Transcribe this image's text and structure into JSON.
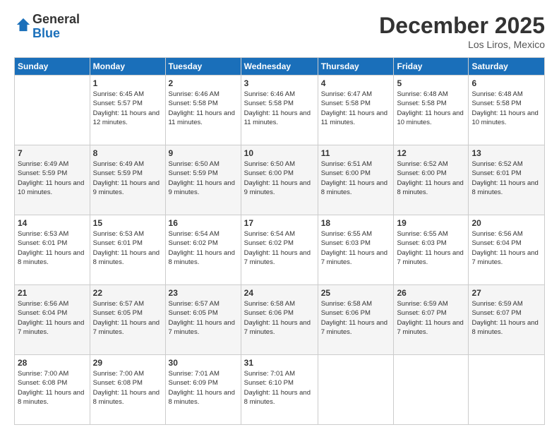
{
  "header": {
    "logo_general": "General",
    "logo_blue": "Blue",
    "month_title": "December 2025",
    "location": "Los Liros, Mexico"
  },
  "days_of_week": [
    "Sunday",
    "Monday",
    "Tuesday",
    "Wednesday",
    "Thursday",
    "Friday",
    "Saturday"
  ],
  "weeks": [
    [
      {
        "num": "",
        "sunrise": "",
        "sunset": "",
        "daylight": ""
      },
      {
        "num": "1",
        "sunrise": "Sunrise: 6:45 AM",
        "sunset": "Sunset: 5:57 PM",
        "daylight": "Daylight: 11 hours and 12 minutes."
      },
      {
        "num": "2",
        "sunrise": "Sunrise: 6:46 AM",
        "sunset": "Sunset: 5:58 PM",
        "daylight": "Daylight: 11 hours and 11 minutes."
      },
      {
        "num": "3",
        "sunrise": "Sunrise: 6:46 AM",
        "sunset": "Sunset: 5:58 PM",
        "daylight": "Daylight: 11 hours and 11 minutes."
      },
      {
        "num": "4",
        "sunrise": "Sunrise: 6:47 AM",
        "sunset": "Sunset: 5:58 PM",
        "daylight": "Daylight: 11 hours and 11 minutes."
      },
      {
        "num": "5",
        "sunrise": "Sunrise: 6:48 AM",
        "sunset": "Sunset: 5:58 PM",
        "daylight": "Daylight: 11 hours and 10 minutes."
      },
      {
        "num": "6",
        "sunrise": "Sunrise: 6:48 AM",
        "sunset": "Sunset: 5:58 PM",
        "daylight": "Daylight: 11 hours and 10 minutes."
      }
    ],
    [
      {
        "num": "7",
        "sunrise": "Sunrise: 6:49 AM",
        "sunset": "Sunset: 5:59 PM",
        "daylight": "Daylight: 11 hours and 10 minutes."
      },
      {
        "num": "8",
        "sunrise": "Sunrise: 6:49 AM",
        "sunset": "Sunset: 5:59 PM",
        "daylight": "Daylight: 11 hours and 9 minutes."
      },
      {
        "num": "9",
        "sunrise": "Sunrise: 6:50 AM",
        "sunset": "Sunset: 5:59 PM",
        "daylight": "Daylight: 11 hours and 9 minutes."
      },
      {
        "num": "10",
        "sunrise": "Sunrise: 6:50 AM",
        "sunset": "Sunset: 6:00 PM",
        "daylight": "Daylight: 11 hours and 9 minutes."
      },
      {
        "num": "11",
        "sunrise": "Sunrise: 6:51 AM",
        "sunset": "Sunset: 6:00 PM",
        "daylight": "Daylight: 11 hours and 8 minutes."
      },
      {
        "num": "12",
        "sunrise": "Sunrise: 6:52 AM",
        "sunset": "Sunset: 6:00 PM",
        "daylight": "Daylight: 11 hours and 8 minutes."
      },
      {
        "num": "13",
        "sunrise": "Sunrise: 6:52 AM",
        "sunset": "Sunset: 6:01 PM",
        "daylight": "Daylight: 11 hours and 8 minutes."
      }
    ],
    [
      {
        "num": "14",
        "sunrise": "Sunrise: 6:53 AM",
        "sunset": "Sunset: 6:01 PM",
        "daylight": "Daylight: 11 hours and 8 minutes."
      },
      {
        "num": "15",
        "sunrise": "Sunrise: 6:53 AM",
        "sunset": "Sunset: 6:01 PM",
        "daylight": "Daylight: 11 hours and 8 minutes."
      },
      {
        "num": "16",
        "sunrise": "Sunrise: 6:54 AM",
        "sunset": "Sunset: 6:02 PM",
        "daylight": "Daylight: 11 hours and 8 minutes."
      },
      {
        "num": "17",
        "sunrise": "Sunrise: 6:54 AM",
        "sunset": "Sunset: 6:02 PM",
        "daylight": "Daylight: 11 hours and 7 minutes."
      },
      {
        "num": "18",
        "sunrise": "Sunrise: 6:55 AM",
        "sunset": "Sunset: 6:03 PM",
        "daylight": "Daylight: 11 hours and 7 minutes."
      },
      {
        "num": "19",
        "sunrise": "Sunrise: 6:55 AM",
        "sunset": "Sunset: 6:03 PM",
        "daylight": "Daylight: 11 hours and 7 minutes."
      },
      {
        "num": "20",
        "sunrise": "Sunrise: 6:56 AM",
        "sunset": "Sunset: 6:04 PM",
        "daylight": "Daylight: 11 hours and 7 minutes."
      }
    ],
    [
      {
        "num": "21",
        "sunrise": "Sunrise: 6:56 AM",
        "sunset": "Sunset: 6:04 PM",
        "daylight": "Daylight: 11 hours and 7 minutes."
      },
      {
        "num": "22",
        "sunrise": "Sunrise: 6:57 AM",
        "sunset": "Sunset: 6:05 PM",
        "daylight": "Daylight: 11 hours and 7 minutes."
      },
      {
        "num": "23",
        "sunrise": "Sunrise: 6:57 AM",
        "sunset": "Sunset: 6:05 PM",
        "daylight": "Daylight: 11 hours and 7 minutes."
      },
      {
        "num": "24",
        "sunrise": "Sunrise: 6:58 AM",
        "sunset": "Sunset: 6:06 PM",
        "daylight": "Daylight: 11 hours and 7 minutes."
      },
      {
        "num": "25",
        "sunrise": "Sunrise: 6:58 AM",
        "sunset": "Sunset: 6:06 PM",
        "daylight": "Daylight: 11 hours and 7 minutes."
      },
      {
        "num": "26",
        "sunrise": "Sunrise: 6:59 AM",
        "sunset": "Sunset: 6:07 PM",
        "daylight": "Daylight: 11 hours and 7 minutes."
      },
      {
        "num": "27",
        "sunrise": "Sunrise: 6:59 AM",
        "sunset": "Sunset: 6:07 PM",
        "daylight": "Daylight: 11 hours and 8 minutes."
      }
    ],
    [
      {
        "num": "28",
        "sunrise": "Sunrise: 7:00 AM",
        "sunset": "Sunset: 6:08 PM",
        "daylight": "Daylight: 11 hours and 8 minutes."
      },
      {
        "num": "29",
        "sunrise": "Sunrise: 7:00 AM",
        "sunset": "Sunset: 6:08 PM",
        "daylight": "Daylight: 11 hours and 8 minutes."
      },
      {
        "num": "30",
        "sunrise": "Sunrise: 7:01 AM",
        "sunset": "Sunset: 6:09 PM",
        "daylight": "Daylight: 11 hours and 8 minutes."
      },
      {
        "num": "31",
        "sunrise": "Sunrise: 7:01 AM",
        "sunset": "Sunset: 6:10 PM",
        "daylight": "Daylight: 11 hours and 8 minutes."
      },
      {
        "num": "",
        "sunrise": "",
        "sunset": "",
        "daylight": ""
      },
      {
        "num": "",
        "sunrise": "",
        "sunset": "",
        "daylight": ""
      },
      {
        "num": "",
        "sunrise": "",
        "sunset": "",
        "daylight": ""
      }
    ]
  ]
}
